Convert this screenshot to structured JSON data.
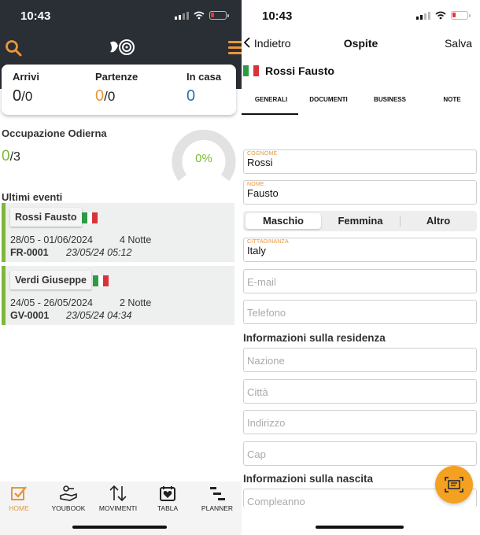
{
  "left": {
    "status_time": "10:43",
    "stats": {
      "arrivals_label": "Arrivi",
      "arrivals_value": "0",
      "arrivals_total": "/0",
      "departures_label": "Partenze",
      "departures_value": "0",
      "departures_total": "/0",
      "inhouse_label": "In casa",
      "inhouse_value": "0"
    },
    "occupancy": {
      "title": "Occupazione Odierna",
      "value": "0",
      "total": "/3",
      "percent": "0%"
    },
    "events_title": "Ultimi eventi",
    "events": [
      {
        "name": "Rossi Fausto",
        "dates": "28/05 - 01/06/2024",
        "nights": "4 Notte",
        "code": "FR-0001",
        "timestamp": "23/05/24 05:12"
      },
      {
        "name": "Verdi Giuseppe",
        "dates": "24/05 - 26/05/2024",
        "nights": "2 Notte",
        "code": "GV-0001",
        "timestamp": "23/05/24 04:34"
      }
    ],
    "tabs": [
      {
        "label": "HOME",
        "icon": "check-square-icon"
      },
      {
        "label": "YOUBOOK",
        "icon": "hand-key-icon"
      },
      {
        "label": "MOVIMENTI",
        "icon": "arrows-updown-icon"
      },
      {
        "label": "TABLA",
        "icon": "heart-board-icon"
      },
      {
        "label": "PLANNER",
        "icon": "planner-bars-icon"
      }
    ],
    "colors": {
      "header_bg": "#2a2e35",
      "accent": "#e9963a",
      "green": "#7cb83a",
      "blue": "#2c6db0"
    }
  },
  "right": {
    "status_time": "10:43",
    "nav": {
      "back": "Indietro",
      "title": "Ospite",
      "save": "Salva"
    },
    "guest_name": "Rossi Fausto",
    "tabs": [
      "GENERALI",
      "DOCUMENTI",
      "BUSINESS",
      "NOTE"
    ],
    "fields": {
      "surname_label": "COGNOME",
      "surname_value": "Rossi",
      "firstname_label": "NOME",
      "firstname_value": "Fausto",
      "citizenship_label": "CITTADINANZA",
      "citizenship_value": "Italy",
      "email_placeholder": "E-mail",
      "phone_placeholder": "Telefono"
    },
    "gender": {
      "options": [
        "Maschio",
        "Femmina",
        "Altro"
      ],
      "selected": "Maschio"
    },
    "residence": {
      "title": "Informazioni sulla residenza",
      "nation": "Nazione",
      "city": "Città",
      "address": "Indirizzo",
      "zip": "Cap"
    },
    "birth": {
      "title": "Informazioni sulla nascita",
      "birthday": "Compleanno"
    }
  }
}
